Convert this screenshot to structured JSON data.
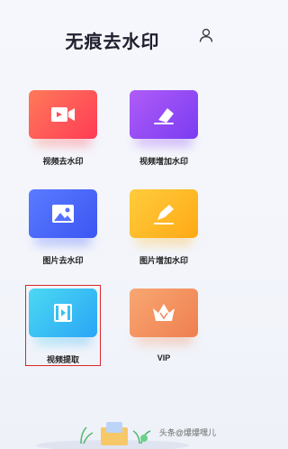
{
  "header": {
    "title": "无痕去水印",
    "user_icon": "user-icon"
  },
  "tools": [
    {
      "label": "视频去水印",
      "icon": "video-camera-icon",
      "color": "#ff4d56"
    },
    {
      "label": "视频增加水印",
      "icon": "eraser-icon",
      "color": "#8a45f4"
    },
    {
      "label": "图片去水印",
      "icon": "image-icon",
      "color": "#4a66fa"
    },
    {
      "label": "图片增加水印",
      "icon": "pencil-icon",
      "color": "#ffb420"
    },
    {
      "label": "视频提取",
      "icon": "video-extract-icon",
      "color": "#36c0f4"
    },
    {
      "label": "VIP",
      "icon": "crown-icon",
      "color": "#f0885a"
    }
  ],
  "watermark": "头条@爆爆嘿儿"
}
